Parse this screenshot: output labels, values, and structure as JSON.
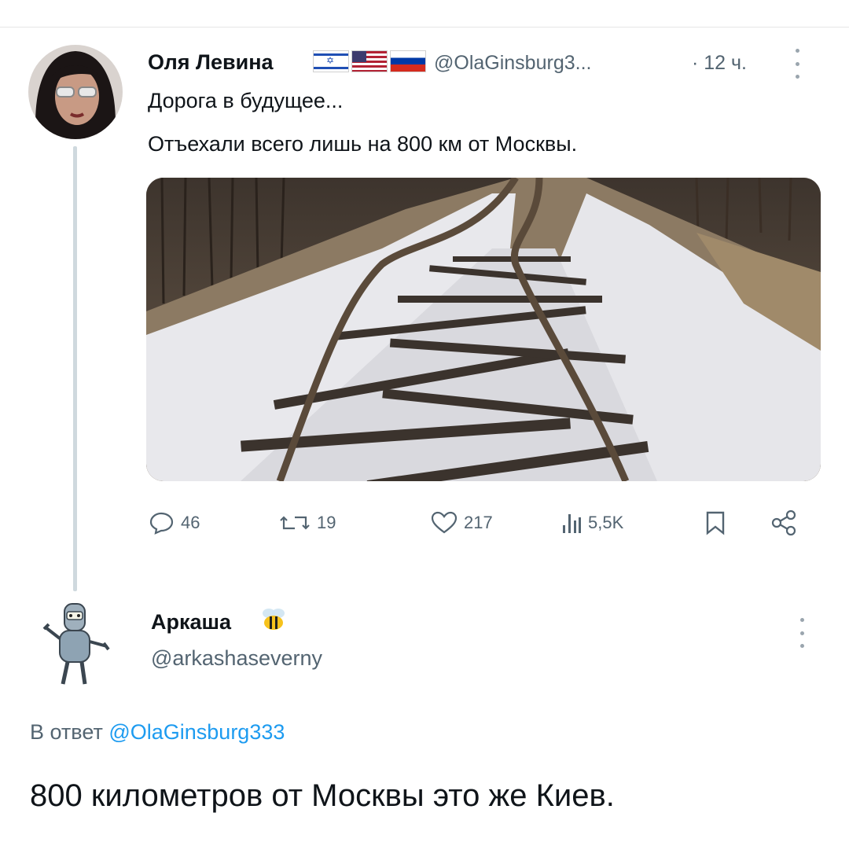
{
  "tweet": {
    "author_name": "Оля Левина",
    "flags": [
      "israel-flag",
      "usa-flag",
      "russia-flag"
    ],
    "handle": "@OlaGinsburg3...",
    "time": "· 12 ч.",
    "text_line1": "Дорога в будущее...",
    "text_line2": "Отъехали всего лишь на 800 км от Москвы.",
    "image": "snowy-broken-railway-photo",
    "stats": {
      "replies": "46",
      "reposts": "19",
      "likes": "217",
      "views": "5,5K"
    }
  },
  "reply": {
    "author_name": "Аркаша",
    "emoji": "bee-emoji",
    "handle": "@arkashaseverny",
    "reply_to_prefix": "В ответ",
    "reply_to_mention": "@OlaGinsburg333",
    "text": "800 километров от Москвы это же Киев."
  },
  "colors": {
    "text": "#0f1419",
    "secondary": "#536471",
    "link": "#1d9bf0",
    "thread_line": "#cfd9de"
  }
}
